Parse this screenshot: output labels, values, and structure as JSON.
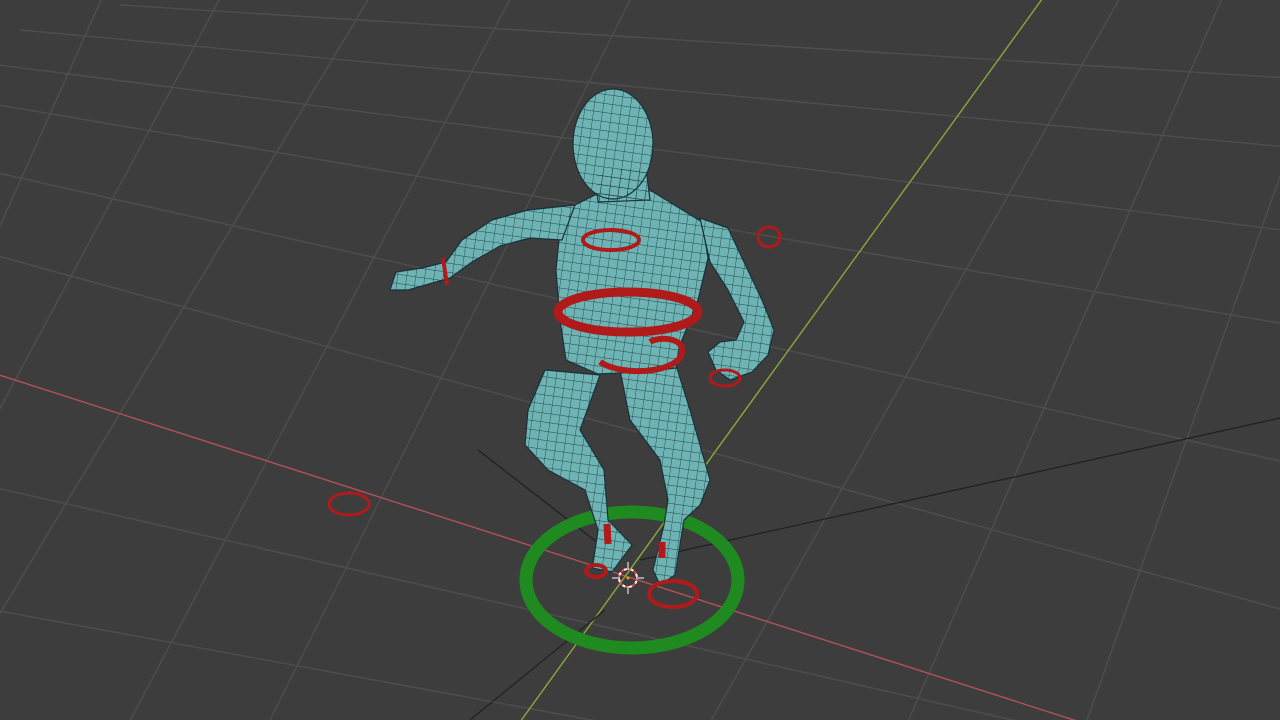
{
  "viewport": {
    "background": "#3d3d3d",
    "colors": {
      "grid_line": "#4e4e4e",
      "x_axis": "#b4505a",
      "y_axis": "#88a83a",
      "dark_line": "#1f1f1f",
      "mesh_fill": "#6fb4b4",
      "mesh_wire": "#17323a",
      "pose_control": "#b11a1a",
      "root_control": "#1f8a1f",
      "cursor_ring_a": "#ff4040",
      "cursor_ring_b": "#ffffff"
    },
    "objects": {
      "mesh": "character-mesh",
      "root_control": "root-circle-control",
      "pose_controls": [
        "chest-control",
        "waist-control",
        "hips-control",
        "hand-control-left",
        "hand-control-right",
        "elbow-pole-control",
        "knee-pole-control",
        "foot-control-left",
        "foot-control-right"
      ],
      "cursor": "3d-cursor-icon"
    }
  }
}
